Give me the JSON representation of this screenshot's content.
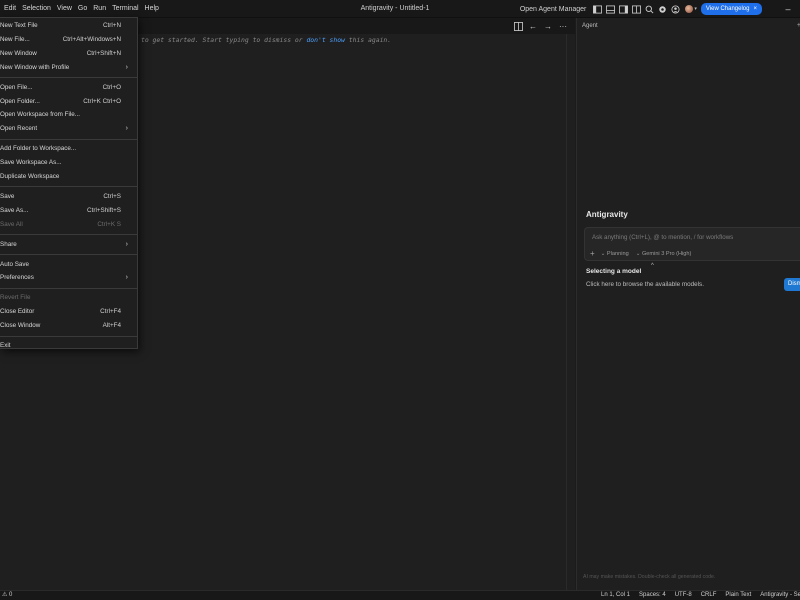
{
  "menubar": {
    "items": [
      "Edit",
      "Selection",
      "View",
      "Go",
      "Run",
      "Terminal",
      "Help"
    ]
  },
  "window": {
    "title": "Antigravity - Untitled-1"
  },
  "titlebar": {
    "agent_manager": "Open Agent Manager",
    "changelog_label": "View Changelog",
    "changelog_close": "×",
    "minimize": "–",
    "accent": "#1f6feb"
  },
  "editor": {
    "hint_prefix": "to get started. Start typing to dismiss or ",
    "hint_link": "don't show",
    "hint_suffix": " this again.",
    "link_color": "#4ea1ff"
  },
  "file_menu": {
    "groups": [
      [
        {
          "label": "New Text File",
          "shortcut": "Ctrl+N"
        },
        {
          "label": "New File...",
          "shortcut": "Ctrl+Alt+Windows+N"
        },
        {
          "label": "New Window",
          "shortcut": "Ctrl+Shift+N"
        },
        {
          "label": "New Window with Profile",
          "submenu": true
        }
      ],
      [
        {
          "label": "Open File...",
          "shortcut": "Ctrl+O"
        },
        {
          "label": "Open Folder...",
          "shortcut": "Ctrl+K Ctrl+O"
        },
        {
          "label": "Open Workspace from File..."
        },
        {
          "label": "Open Recent",
          "submenu": true
        }
      ],
      [
        {
          "label": "Add Folder to Workspace..."
        },
        {
          "label": "Save Workspace As..."
        },
        {
          "label": "Duplicate Workspace"
        }
      ],
      [
        {
          "label": "Save",
          "shortcut": "Ctrl+S"
        },
        {
          "label": "Save As...",
          "shortcut": "Ctrl+Shift+S"
        },
        {
          "label": "Save All",
          "shortcut": "Ctrl+K S",
          "disabled": true
        }
      ],
      [
        {
          "label": "Share",
          "submenu": true
        }
      ],
      [
        {
          "label": "Auto Save"
        },
        {
          "label": "Preferences",
          "submenu": true
        }
      ],
      [
        {
          "label": "Revert File",
          "disabled": true
        },
        {
          "label": "Close Editor",
          "shortcut": "Ctrl+F4"
        },
        {
          "label": "Close Window",
          "shortcut": "Alt+F4"
        }
      ],
      [
        {
          "label": "Exit"
        }
      ]
    ]
  },
  "agent": {
    "panel_title": "Agent",
    "name": "Antigravity",
    "input_placeholder": "Ask anything (Ctrl+L), @ to mention, / for workflows",
    "add": "+",
    "mode": "Planning",
    "model": "Gemini 3 Pro (High)",
    "notice_title": "Selecting a model",
    "notice_desc": "Click here to browse the available models.",
    "dismiss": "Dism",
    "footer": "AI may make mistakes. Double-check all generated code."
  },
  "statusbar": {
    "left": "⚠ 0",
    "position": "Ln 1, Col 1",
    "spaces": "Spaces: 4",
    "encoding": "UTF-8",
    "eol": "CRLF",
    "language": "Plain Text",
    "app": "Antigravity - Se"
  }
}
